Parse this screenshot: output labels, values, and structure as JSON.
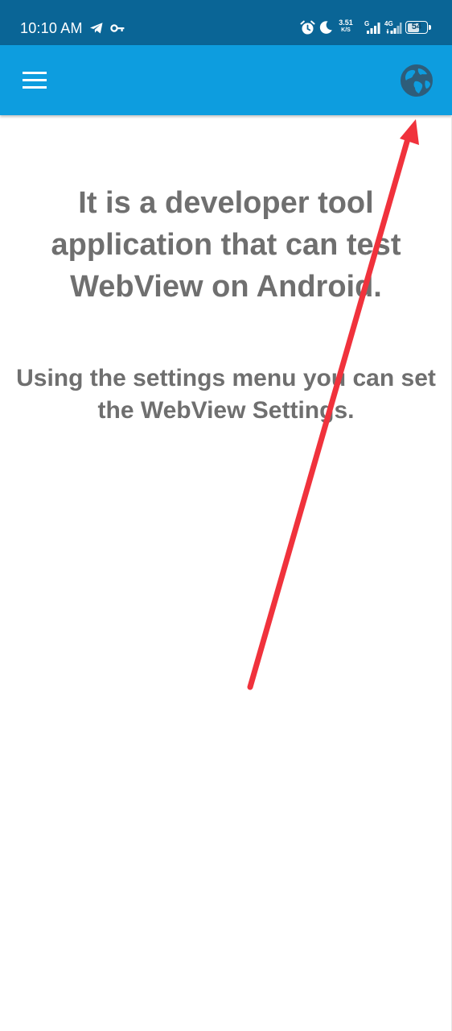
{
  "status_bar": {
    "time": "10:10 AM",
    "net_speed_value": "3.51",
    "net_speed_unit": "K/S",
    "sim1_label": "G",
    "sim2_label": "4G",
    "battery_level": "54",
    "icons": [
      "telegram-icon",
      "key-icon",
      "alarm-icon",
      "moon-icon",
      "signal-icon",
      "signal-icon",
      "battery-icon"
    ]
  },
  "app_bar": {
    "menu_icon": "hamburger-menu-icon",
    "action_icon": "globe-icon",
    "color": "#0d9ddf"
  },
  "content": {
    "headline": "It is a developer tool application that can test WebView on Android.",
    "subtext": "Using the settings menu you can set the WebView Settings."
  },
  "annotation": {
    "type": "red-arrow",
    "points_to": "globe-icon",
    "color": "#f0323c"
  },
  "colors": {
    "status_bar": "#0a6596",
    "app_bar": "#0d9ddf",
    "text": "#6f6f6f",
    "background": "#ffffff"
  }
}
